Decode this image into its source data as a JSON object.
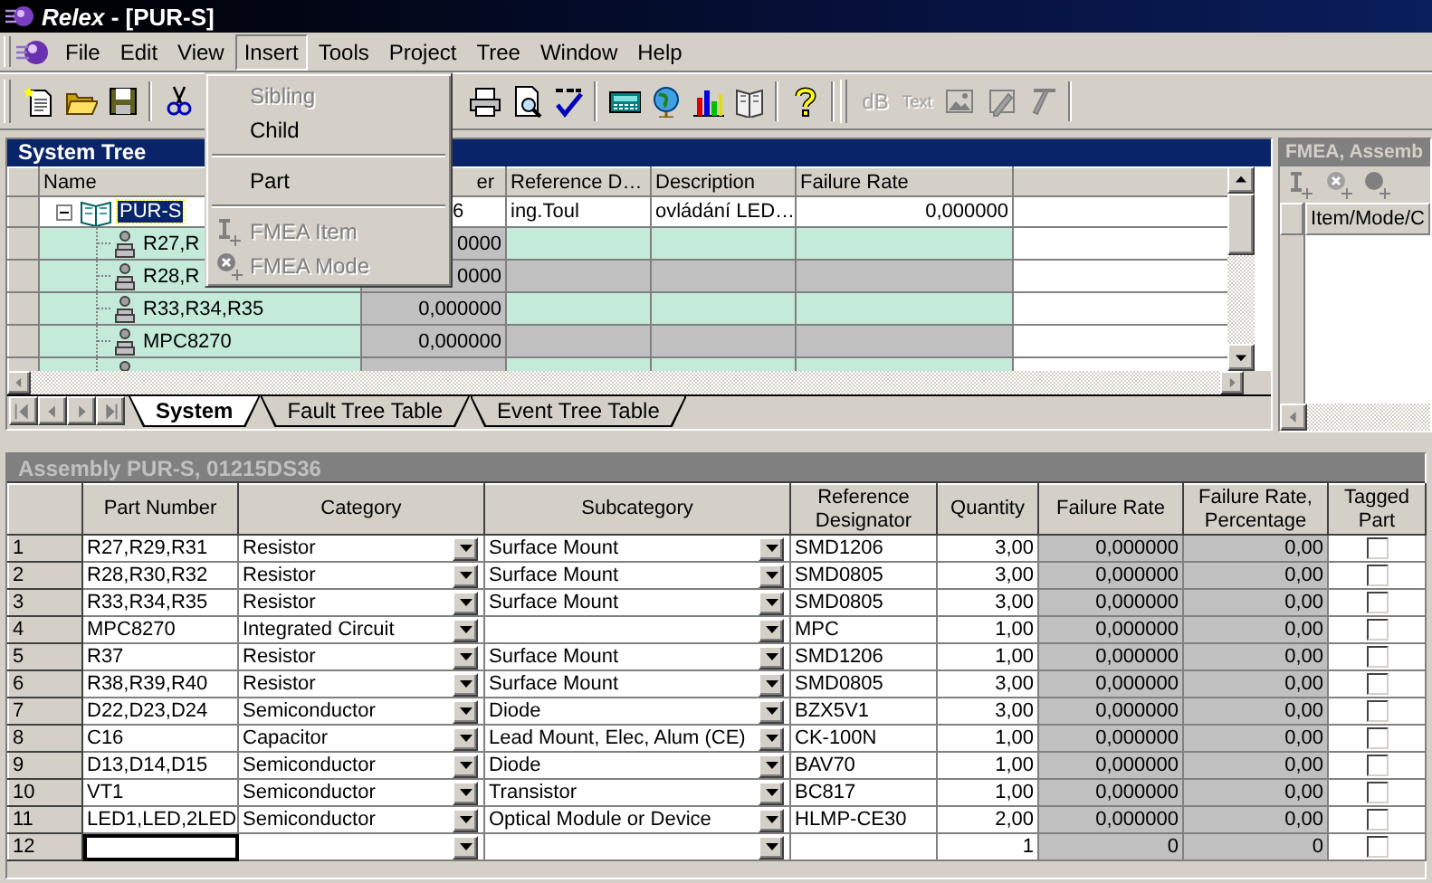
{
  "window": {
    "title": "*Relex* - [PUR-S]"
  },
  "menu_bar": [
    {
      "label": "File",
      "selected": false
    },
    {
      "label": "Edit",
      "selected": false
    },
    {
      "label": "View",
      "selected": false
    },
    {
      "label": "Insert",
      "selected": true
    },
    {
      "label": "Tools",
      "selected": false
    },
    {
      "label": "Project",
      "selected": false
    },
    {
      "label": "Tree",
      "selected": false
    },
    {
      "label": "Window",
      "selected": false
    },
    {
      "label": "Help",
      "selected": false
    }
  ],
  "insert_menu": [
    {
      "kind": "item",
      "label": "Sibling",
      "disabled": true
    },
    {
      "kind": "item",
      "label": "Child",
      "disabled": false
    },
    {
      "kind": "separator"
    },
    {
      "kind": "item",
      "label": "Part",
      "disabled": false
    },
    {
      "kind": "separator"
    },
    {
      "kind": "icon_item",
      "label": "FMEA Item",
      "disabled": true
    },
    {
      "kind": "icon_item",
      "label": "FMEA Mode",
      "disabled": true
    }
  ],
  "format_toolbar": {
    "disabled": true,
    "labels": [
      "dB",
      "Text"
    ]
  },
  "system_tree": {
    "title": "System Tree",
    "columns": [
      "Name",
      "er",
      "Reference D…",
      "Description",
      "Failure Rate"
    ],
    "root": {
      "name": "PUR-S",
      "selected": true,
      "expanded": true,
      "cells": [
        "6",
        "ing.Toul",
        "ovládání LED…",
        "0,000000"
      ],
      "children": [
        {
          "name": "R27,R",
          "cells": [
            {
              "text": "0000",
              "read_only": true
            },
            {
              "read_only": false
            },
            {
              "read_only": false
            },
            {
              "read_only": false
            }
          ]
        },
        {
          "name": "R28,R",
          "cells": [
            {
              "text": "0000",
              "read_only": true
            },
            {
              "read_only": true
            },
            {
              "read_only": true
            },
            {
              "read_only": true
            }
          ]
        },
        {
          "name": "R33,R34,R35",
          "cells": [
            {
              "text": "0,000000",
              "read_only": true
            },
            {
              "read_only": false
            },
            {
              "read_only": false
            },
            {
              "read_only": false
            }
          ]
        },
        {
          "name": "MPC8270",
          "cells": [
            {
              "text": "0,000000",
              "read_only": true
            },
            {
              "read_only": true
            },
            {
              "read_only": true
            },
            {
              "read_only": true
            }
          ]
        },
        {
          "cells": [
            {
              "read_only": true
            },
            {
              "read_only": false
            },
            {
              "read_only": false
            },
            {
              "read_only": false
            }
          ]
        }
      ]
    }
  },
  "tabs": [
    {
      "label": "System",
      "selected": true
    },
    {
      "label": "Fault Tree Table",
      "selected": false
    },
    {
      "label": "Event Tree Table",
      "selected": false
    }
  ],
  "fmea_panel": {
    "title": "FMEA, Assemb",
    "columns": [
      "Item/Mode/C"
    ]
  },
  "assembly": {
    "title": "Assembly PUR-S, 01215DS36",
    "columns": [
      "Part Number",
      "Category",
      "Subcategory",
      "Reference Designator",
      "Quantity",
      "Failure Rate",
      "Failure Rate, Percentage",
      "Tagged Part"
    ],
    "rows": [
      {
        "number": "1",
        "part_number": "R27,R29,R31",
        "category": "Resistor",
        "subcategory": "Surface Mount",
        "reference": "SMD1206",
        "quantity": "3,00",
        "failure_rate": "0,000000",
        "percentage": "0,00",
        "tagged": false,
        "focused": false
      },
      {
        "number": "2",
        "part_number": "R28,R30,R32",
        "category": "Resistor",
        "subcategory": "Surface Mount",
        "reference": "SMD0805",
        "quantity": "3,00",
        "failure_rate": "0,000000",
        "percentage": "0,00",
        "tagged": false,
        "focused": false
      },
      {
        "number": "3",
        "part_number": "R33,R34,R35",
        "category": "Resistor",
        "subcategory": "Surface Mount",
        "reference": "SMD0805",
        "quantity": "3,00",
        "failure_rate": "0,000000",
        "percentage": "0,00",
        "tagged": false,
        "focused": false
      },
      {
        "number": "4",
        "part_number": "MPC8270",
        "category": "Integrated Circuit",
        "reference": "MPC",
        "quantity": "1,00",
        "failure_rate": "0,000000",
        "percentage": "0,00",
        "tagged": false,
        "focused": false
      },
      {
        "number": "5",
        "part_number": "R37",
        "category": "Resistor",
        "subcategory": "Surface Mount",
        "reference": "SMD1206",
        "quantity": "1,00",
        "failure_rate": "0,000000",
        "percentage": "0,00",
        "tagged": false,
        "focused": false
      },
      {
        "number": "6",
        "part_number": "R38,R39,R40",
        "category": "Resistor",
        "subcategory": "Surface Mount",
        "reference": "SMD0805",
        "quantity": "3,00",
        "failure_rate": "0,000000",
        "percentage": "0,00",
        "tagged": false,
        "focused": false
      },
      {
        "number": "7",
        "part_number": "D22,D23,D24",
        "category": "Semiconductor",
        "subcategory": "Diode",
        "reference": "BZX5V1",
        "quantity": "3,00",
        "failure_rate": "0,000000",
        "percentage": "0,00",
        "tagged": false,
        "focused": false
      },
      {
        "number": "8",
        "part_number": "C16",
        "category": "Capacitor",
        "subcategory": "Lead Mount, Elec, Alum (CE)",
        "reference": "CK-100N",
        "quantity": "1,00",
        "failure_rate": "0,000000",
        "percentage": "0,00",
        "tagged": false,
        "focused": false
      },
      {
        "number": "9",
        "part_number": "D13,D14,D15",
        "category": "Semiconductor",
        "subcategory": "Diode",
        "reference": "BAV70",
        "quantity": "1,00",
        "failure_rate": "0,000000",
        "percentage": "0,00",
        "tagged": false,
        "focused": false
      },
      {
        "number": "10",
        "part_number": "VT1",
        "category": "Semiconductor",
        "subcategory": "Transistor",
        "reference": "BC817",
        "quantity": "1,00",
        "failure_rate": "0,000000",
        "percentage": "0,00",
        "tagged": false,
        "focused": false
      },
      {
        "number": "11",
        "part_number": "LED1,LED,2LED",
        "category": "Semiconductor",
        "subcategory": "Optical Module or Device",
        "reference": "HLMP-CE30",
        "quantity": "2,00",
        "failure_rate": "0,000000",
        "percentage": "0,00",
        "tagged": false,
        "focused": false
      },
      {
        "number": "12",
        "quantity": "1",
        "failure_rate": "0",
        "percentage": "0",
        "tagged": false,
        "focused": true
      }
    ]
  }
}
